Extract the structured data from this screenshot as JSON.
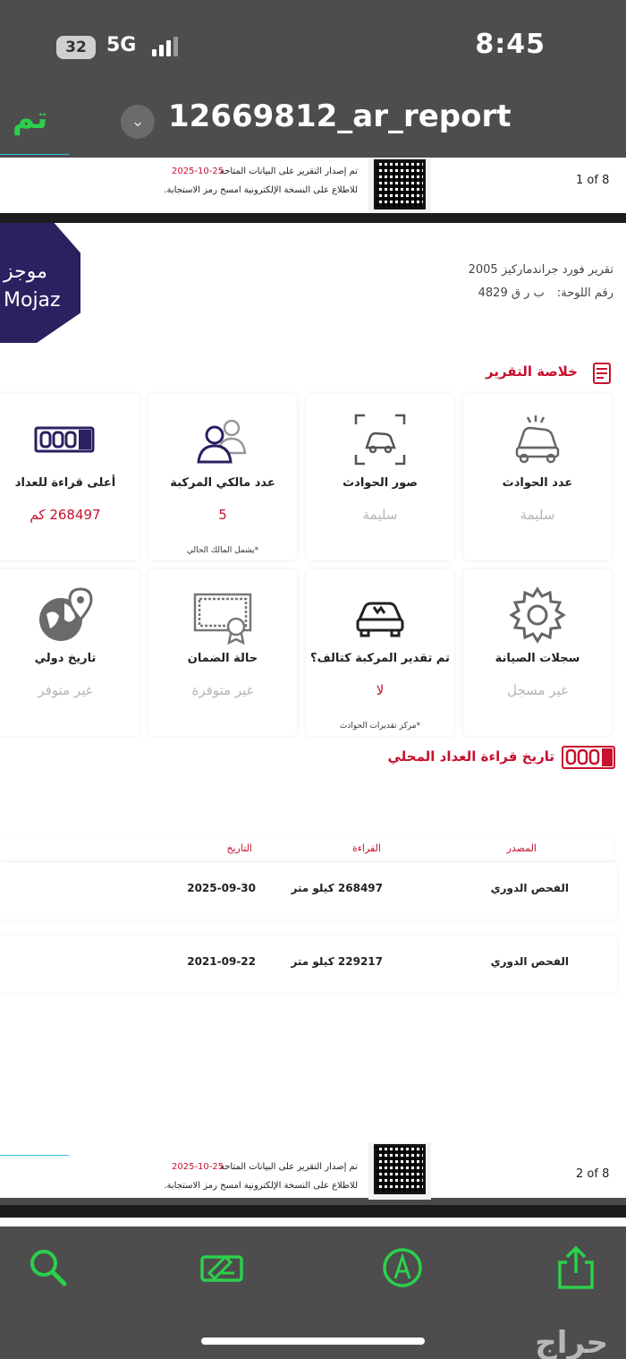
{
  "status": {
    "battery": "32",
    "network": "5G",
    "time": "8:45"
  },
  "header": {
    "done_label": "تم",
    "title": "12669812_ar_report"
  },
  "footer": {
    "line1": "تم إصدار التقرير على البيانات المتاحة",
    "date": "2025-10-25",
    "line2": "للاطلاع على النسخة الإلكترونية امسح رمز الاستجابة.",
    "page1": "1 of 8",
    "page2": "2 of 8"
  },
  "logo": {
    "ar": "موجز",
    "en": "Mojaz"
  },
  "report": {
    "title": "تقرير فورد جراندماركيز 2005",
    "plate_label": "رقم اللوحة:",
    "plate_value": "ب ر ق 4829"
  },
  "summary": {
    "heading": "خلاصة التقرير",
    "cards": [
      {
        "label": "عدد الحوادث",
        "value": "سليمة",
        "icon": "car-crash-icon"
      },
      {
        "label": "صور الحوادث",
        "value": "سليمة",
        "icon": "accident-photo-icon"
      },
      {
        "label": "عدد مالكي المركبة",
        "value": "5",
        "note": "*يشمل المالك الحالي",
        "icon": "owners-icon"
      },
      {
        "label": "أعلى قراءة للعداد",
        "value": "268497 كم",
        "icon": "odometer-icon"
      },
      {
        "label": "سجلات الصيانة",
        "value": "غير مسجل",
        "icon": "gear-icon"
      },
      {
        "label": "تم تقدير المركبة كتالف؟",
        "value": "لا",
        "note": "*مركز تقديرات الحوادث",
        "icon": "damaged-car-icon"
      },
      {
        "label": "حالة الضمان",
        "value": "غير متوفرة",
        "icon": "certificate-icon"
      },
      {
        "label": "تاريخ دولي",
        "value": "غير متوفر",
        "icon": "globe-pin-icon"
      }
    ]
  },
  "odometer_history": {
    "heading": "تاريخ قراءة العداد المحلي",
    "columns": {
      "source": "المصدر",
      "reading": "القراءة",
      "date": "التاريخ"
    },
    "rows": [
      {
        "source": "الفحص الدوري",
        "reading": "268497 كيلو متر",
        "date": "2025-09-30"
      },
      {
        "source": "الفحص الدوري",
        "reading": "229217 كيلو متر",
        "date": "2021-09-22"
      }
    ]
  },
  "toolbar": {
    "watermark": "حراج"
  },
  "colors": {
    "accent_red": "#c8102e",
    "brand_navy": "#2b2060",
    "ios_green": "#2bd04b"
  }
}
